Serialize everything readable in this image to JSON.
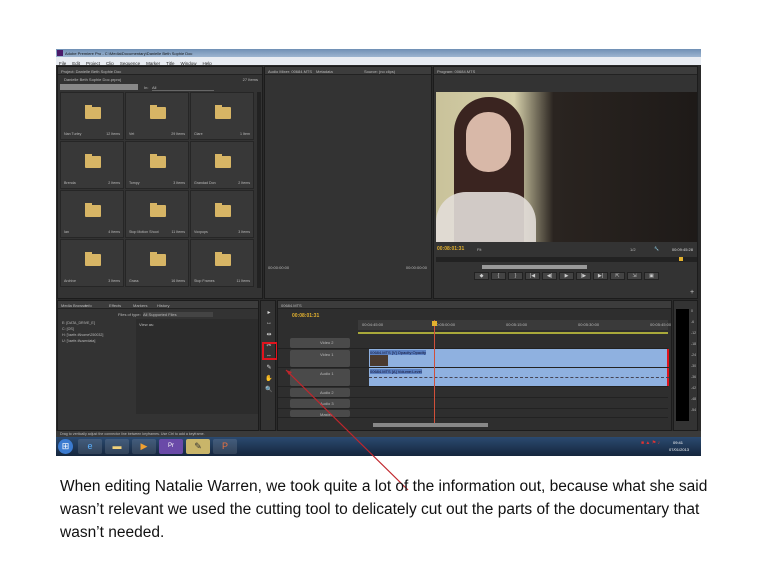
{
  "window": {
    "title": "Adobe Premiere Pro - C:\\Media\\Documentary\\Danielle Beth Sophie Doc"
  },
  "menu": [
    "File",
    "Edit",
    "Project",
    "Clip",
    "Sequence",
    "Marker",
    "Title",
    "Window",
    "Help"
  ],
  "project": {
    "tab": "Project: Danielle Beth Sophie Doc",
    "path": "Danielle Beth Sophie Doc.prproj",
    "count": "27 Items",
    "search_label": "In:",
    "search_value": "All",
    "folders": [
      {
        "name": "Nan Turley",
        "count": "12 Items"
      },
      {
        "name": "Vet",
        "count": "29 Items"
      },
      {
        "name": "Clare",
        "count": "1 Item"
      },
      {
        "name": "Brenda",
        "count": "2 Items"
      },
      {
        "name": "Tompy",
        "count": "3 Items"
      },
      {
        "name": "Grandad Don",
        "count": "2 Items"
      },
      {
        "name": "Ian",
        "count": "4 Items"
      },
      {
        "name": "Stop Motion Shoot",
        "count": "11 Items"
      },
      {
        "name": "Voxpops",
        "count": "3 Items"
      },
      {
        "name": "Archive",
        "count": "3 Items"
      },
      {
        "name": "Grass",
        "count": "16 Items"
      },
      {
        "name": "Stop Frames",
        "count": "11 Items"
      }
    ]
  },
  "source": {
    "tabs": [
      "Audio Mixer: 00684.MTS",
      "Metadata",
      "Source: (no clips)"
    ],
    "tc_left": "00:00:00:00",
    "tc_right": "00:00:00:00"
  },
  "program": {
    "tab": "Program: 00684.MTS",
    "timecode": "00:08:01:31",
    "fit": "Fit",
    "res": "1/2",
    "duration": "00:09:45:28",
    "controls": [
      "◆",
      "{",
      "}",
      "|◀",
      "◀|",
      "▶",
      "|▶",
      "▶|",
      "⇱",
      "⇲",
      "▣"
    ]
  },
  "media_browser": {
    "tabs": [
      "Media Browser",
      "Info",
      "Effects",
      "Markers",
      "History"
    ],
    "files_label": "Files of type:",
    "files_value": "All Supported Files",
    "view_as": "View as:",
    "drives": [
      "E: [DATA_DRIVE_E]",
      "C: [OS]",
      "H: [\\\\sefe-ti\\home\\250032]",
      "U: [\\\\sefe-ti\\userdata]"
    ]
  },
  "timeline": {
    "tab": "00684.MTS",
    "timecode": "00:08:01:31",
    "ruler": [
      "00:04:45:00",
      "00:05:00:00",
      "00:05:15:00",
      "00:05:30:00",
      "00:05:45:00"
    ],
    "tracks": [
      "Video 2",
      "Video 1",
      "Audio 1",
      "Audio 2",
      "Audio 3",
      "Master"
    ],
    "video_clip": "00684.MTS [V]  Opacity:Opacity",
    "audio_clip": "00684.MTS [A]  Volume:Level"
  },
  "meter": [
    "0",
    "-6",
    "-12",
    "-18",
    "-24",
    "-30",
    "-36",
    "-42",
    "-48",
    "-54"
  ],
  "status": "Drag to vertically adjust the connector line between keyframes. Use Ctrl to add a keyframe.",
  "taskbar": {
    "time": "09:41",
    "date": "07/01/2013"
  },
  "caption": "When editing Natalie Warren, we took quite a lot of the information out, because what she said wasn’t relevant we used the cutting tool to delicately cut out the parts of the documentary that wasn’t needed.",
  "colors": {
    "accent": "#e3b12f",
    "clip": "#8fb1e0",
    "highlight": "#e0141e"
  }
}
